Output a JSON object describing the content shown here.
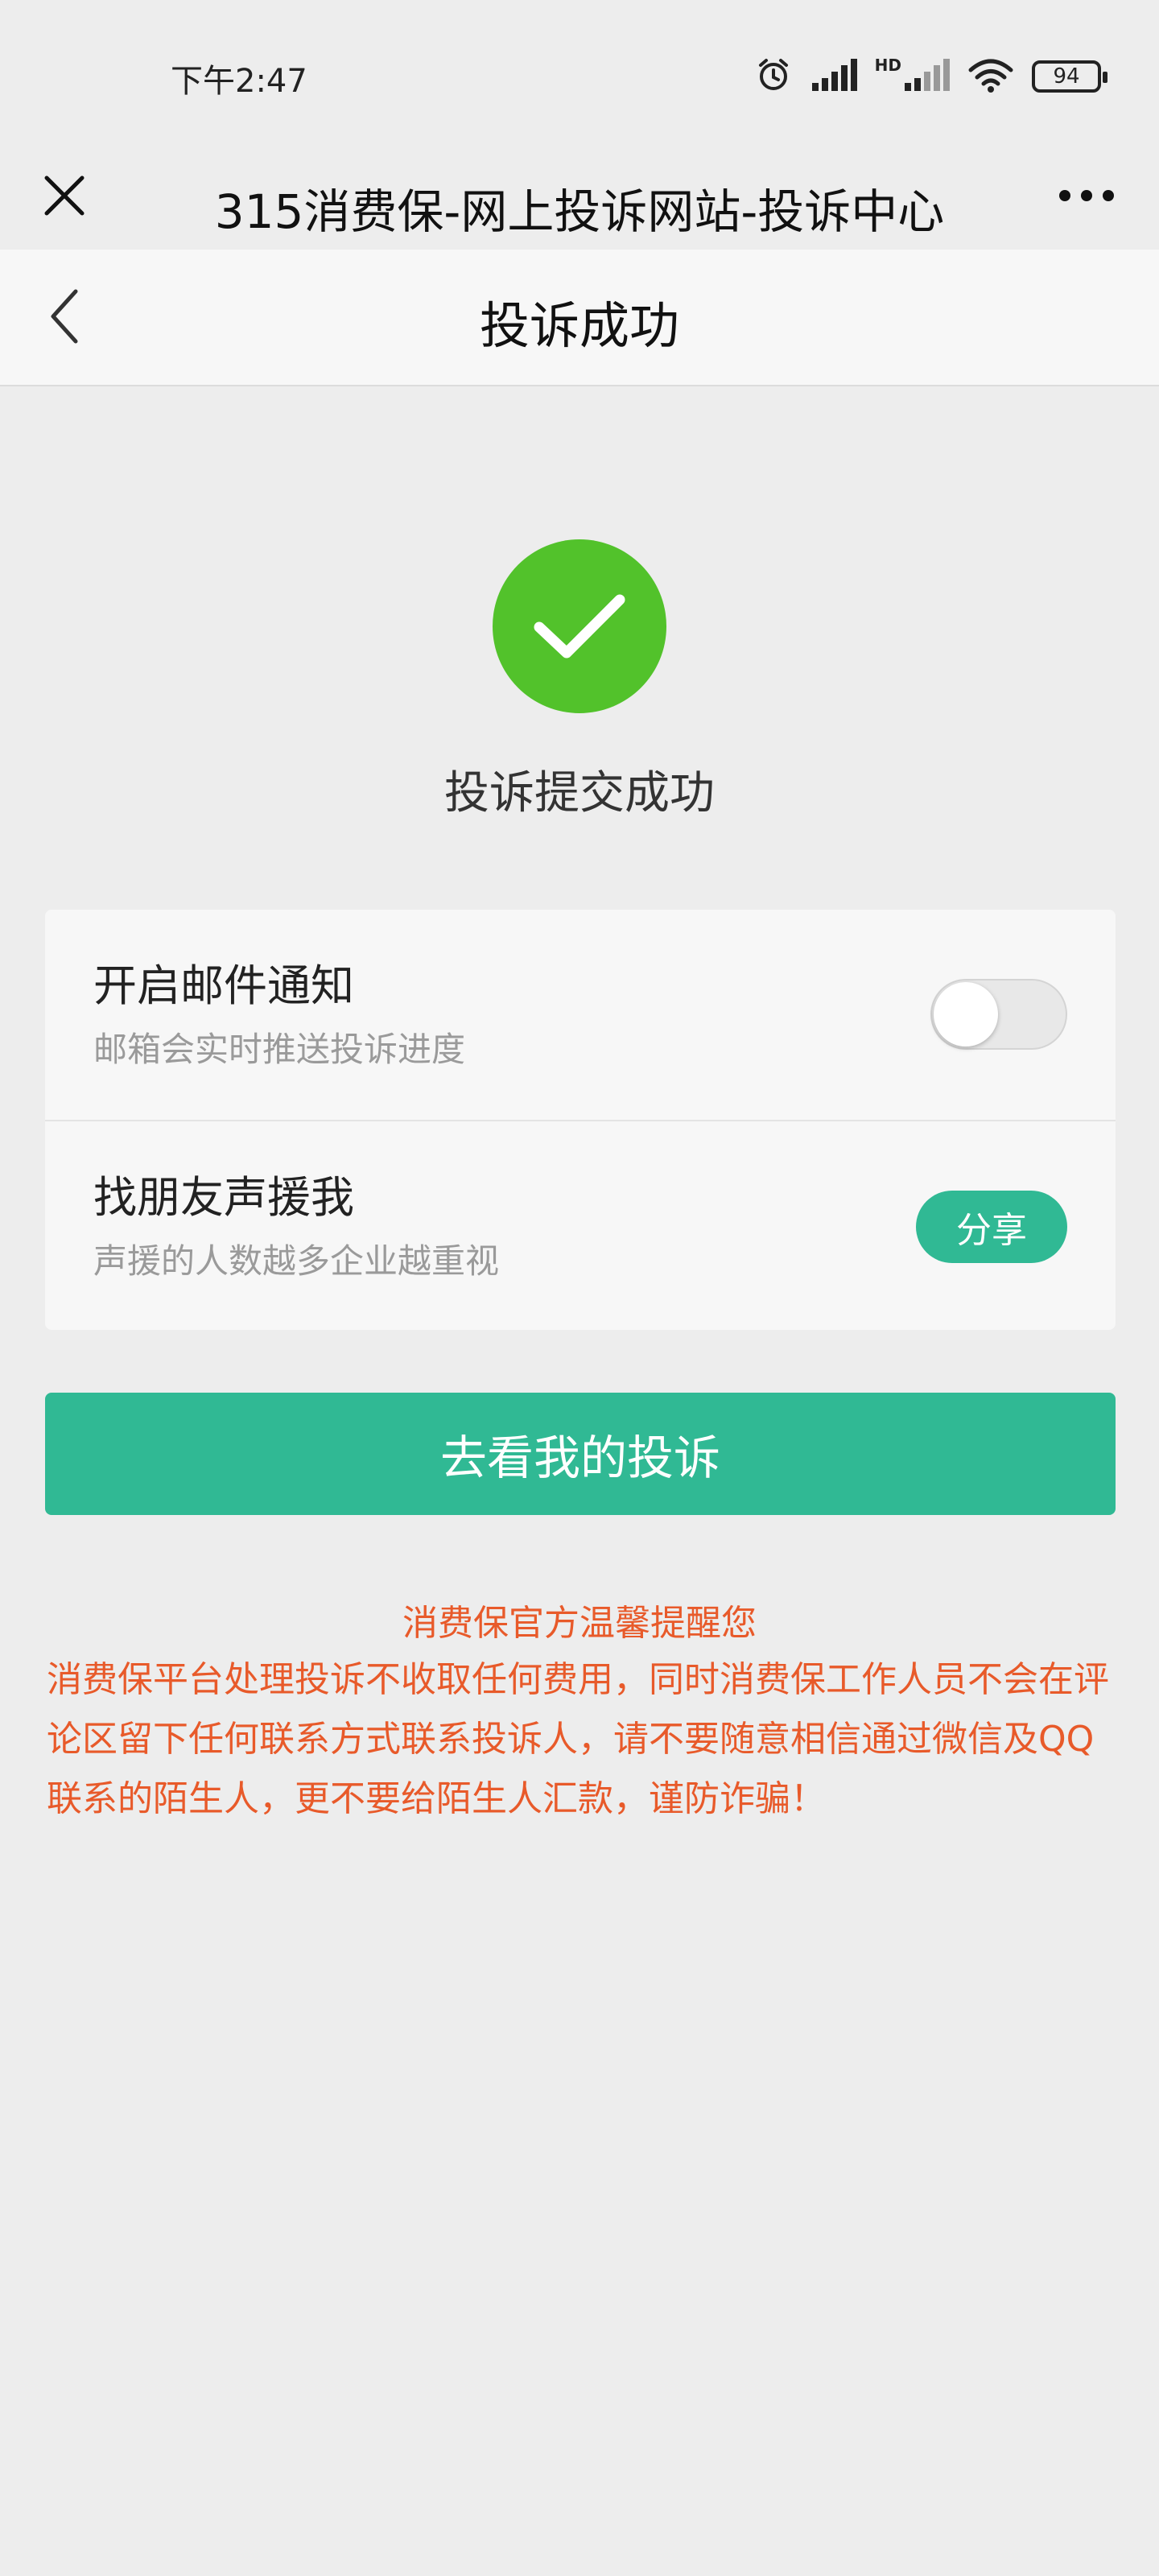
{
  "status_bar": {
    "time": "下午2:47",
    "hd_label": "HD",
    "battery": "94"
  },
  "title_bar": {
    "title": "315消费保-网上投诉网站-投诉中心"
  },
  "nav": {
    "title": "投诉成功"
  },
  "success": {
    "message": "投诉提交成功"
  },
  "card": {
    "email_notify": {
      "title": "开启邮件通知",
      "subtitle": "邮箱会实时推送投诉进度"
    },
    "friends_support": {
      "title": "找朋友声援我",
      "subtitle": "声援的人数越多企业越重视",
      "share_label": "分享"
    }
  },
  "main_button": {
    "label": "去看我的投诉"
  },
  "reminder": {
    "title": "消费保官方温馨提醒您",
    "body": "消费保平台处理投诉不收取任何费用，同时消费保工作人员不会在评论区留下任何联系方式联系投诉人，请不要随意相信通过微信及QQ 联系的陌生人，更不要给陌生人汇款，谨防诈骗！"
  },
  "colors": {
    "accent": "#30b994",
    "success": "#52c22b",
    "warning_text": "#e85a2a"
  }
}
